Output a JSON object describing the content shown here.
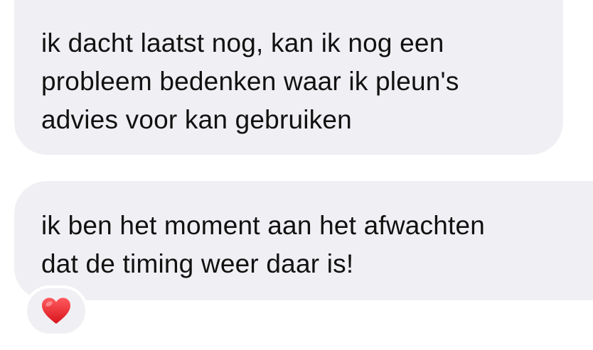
{
  "messages": [
    {
      "text": "ik dacht laatst nog, kan ik nog een\nprobleem bedenken waar ik pleun's\nadvies voor kan gebruiken"
    },
    {
      "text": "ik ben het moment aan het afwachten\ndat de timing weer daar is!",
      "reaction": {
        "icon": "red-heart-icon",
        "color": "#e3232b"
      }
    }
  ],
  "colors": {
    "bubble_background": "#f0f0f4",
    "text": "#111111",
    "page_background": "#ffffff"
  }
}
